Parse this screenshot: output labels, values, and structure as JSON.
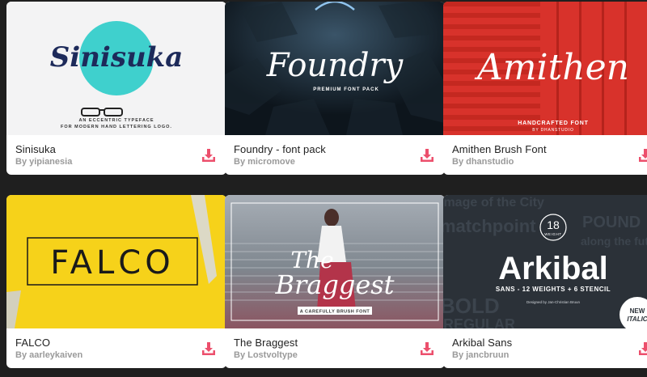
{
  "colors": {
    "download_accent": "#ec4f6c",
    "card_bg": "#ffffff",
    "page_bg": "#1f1f1f"
  },
  "cards": [
    {
      "title": "Sinisuka",
      "author": "By yipianesia",
      "preview": {
        "wordmark": "Sinisuka",
        "tagline_1": "AN ECCENTRIC TYPEFACE",
        "tagline_2": "FOR MODERN HAND LETTERING LOGO."
      }
    },
    {
      "title": "Foundry - font pack",
      "author": "By micromove",
      "preview": {
        "wordmark": "Foundry",
        "tagline_1": "PREMIUM FONT PACK"
      }
    },
    {
      "title": "Amithen Brush Font",
      "author": "By dhanstudio",
      "preview": {
        "wordmark": "Amithen",
        "tagline_1": "HANDCRAFTED FONT",
        "tagline_2": "BY DHANSTUDIO"
      }
    },
    {
      "title": "FALCO",
      "author": "By aarleykaiven",
      "preview": {
        "wordmark": "FALCO"
      }
    },
    {
      "title": "The Braggest",
      "author": "By Lostvoltype",
      "preview": {
        "wordmark_1": "The",
        "wordmark_2": "Braggest",
        "tagline_1": "A CAREFULLY BRUSH FONT"
      }
    },
    {
      "title": "Arkibal Sans",
      "author": "By jancbruun",
      "preview": {
        "badge_number": "18",
        "badge_label": "WEIGHT",
        "wordmark": "Arkibal",
        "tagline_1": "SANS - 12 WEIGHTS + 6 STENCIL",
        "tagline_2": "Designed by Jan-Christian Bruun",
        "corner_badge_1": "NEW",
        "corner_badge_2": "ITALIC",
        "bg_words": [
          "Image of the City",
          "POUND",
          "matchpoint",
          "along the future",
          "BOLD",
          "REGULAR"
        ]
      }
    }
  ],
  "icons": {
    "download": "download-icon"
  }
}
